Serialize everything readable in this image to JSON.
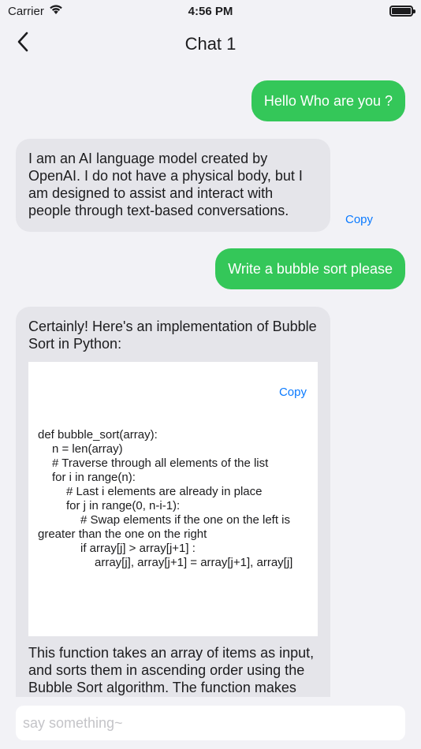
{
  "status_bar": {
    "carrier": "Carrier",
    "time": "4:56 PM"
  },
  "nav": {
    "title": "Chat 1"
  },
  "messages": [
    {
      "role": "user",
      "text": "Hello Who are you ?"
    },
    {
      "role": "bot",
      "text": "I am an AI language model created by OpenAI. I do not have a physical body, but I am designed to assist and interact with people through text-based conversations.",
      "copy_label": "Copy"
    },
    {
      "role": "user",
      "text": "Write a bubble sort please"
    },
    {
      "role": "bot",
      "intro": "Certainly! Here's an implementation of Bubble Sort in Python:",
      "code_copy_label": "Copy",
      "code_lines": [
        "def bubble_sort(array):",
        "    n = len(array)",
        "    # Traverse through all elements of the list",
        "    for i in range(n):",
        "        # Last i elements are already in place",
        "        for j in range(0, n-i-1):",
        "            # Swap elements if the one on the left is greater than the one on the right",
        "            if array[j] > array[j+1] :",
        "                array[j], array[j+1] = array[j+1], array[j]"
      ],
      "outro": "This function takes an array of items as input, and sorts them in ascending order using the Bubble Sort algorithm. The function makes use of two nested loops to"
    }
  ],
  "input": {
    "placeholder": "say something~",
    "value": ""
  },
  "icons": {
    "wifi": "wifi-icon",
    "battery": "battery-icon",
    "back": "chevron-left-icon"
  }
}
